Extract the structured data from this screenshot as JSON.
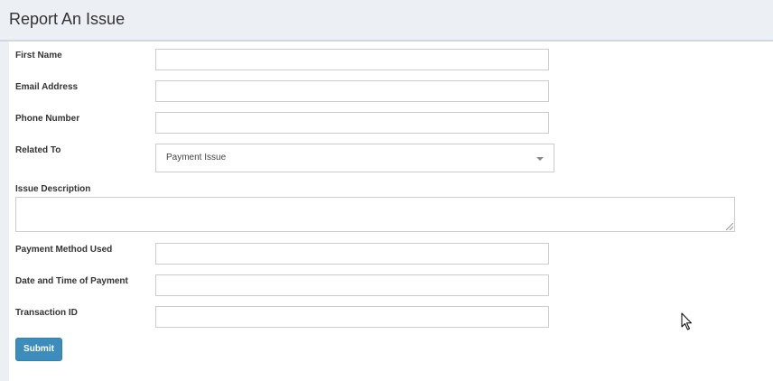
{
  "header": {
    "title": "Report An Issue"
  },
  "form": {
    "first_name": {
      "label": "First Name",
      "value": ""
    },
    "email": {
      "label": "Email Address",
      "value": ""
    },
    "phone": {
      "label": "Phone Number",
      "value": ""
    },
    "related_to": {
      "label": "Related To",
      "value": "Payment Issue"
    },
    "description": {
      "label": "Issue Description",
      "value": ""
    },
    "payment_method": {
      "label": "Payment Method Used",
      "value": ""
    },
    "payment_datetime": {
      "label": "Date and Time of Payment",
      "value": ""
    },
    "transaction_id": {
      "label": "Transaction ID",
      "value": ""
    },
    "submit_label": "Submit"
  },
  "colors": {
    "header_bg": "#ecf0f5",
    "primary_button": "#3c8dbc"
  },
  "icons": {
    "dropdown": "chevron-down-icon",
    "cursor": "mouse-pointer-icon"
  }
}
